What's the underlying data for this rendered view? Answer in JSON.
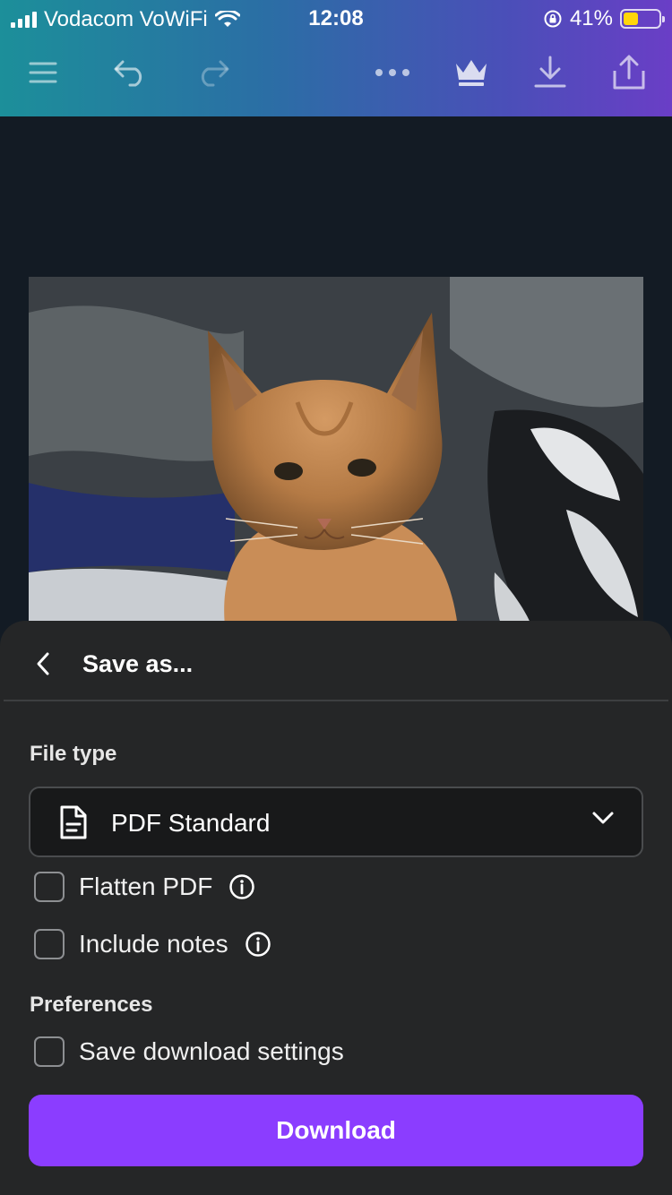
{
  "status_bar": {
    "carrier": "Vodacom VoWiFi",
    "time": "12:08",
    "battery_percent": "41%",
    "battery_level": 0.41,
    "battery_color": "#ffd60a"
  },
  "toolbar": {
    "icons": [
      "menu-icon",
      "undo-icon",
      "redo-icon",
      "more-icon",
      "crown-icon",
      "download-icon",
      "share-icon"
    ],
    "gradient": [
      "#1c8f9a",
      "#6a3ec6"
    ]
  },
  "sheet": {
    "title": "Save as...",
    "file_type_label": "File type",
    "file_type_value": "PDF Standard",
    "options": [
      {
        "label": "Flatten PDF",
        "checked": false,
        "has_info": true
      },
      {
        "label": "Include notes",
        "checked": false,
        "has_info": true
      }
    ],
    "preferences_label": "Preferences",
    "preferences": [
      {
        "label": "Save download settings",
        "checked": false
      }
    ],
    "download_label": "Download",
    "accent_color": "#8b3dff"
  }
}
